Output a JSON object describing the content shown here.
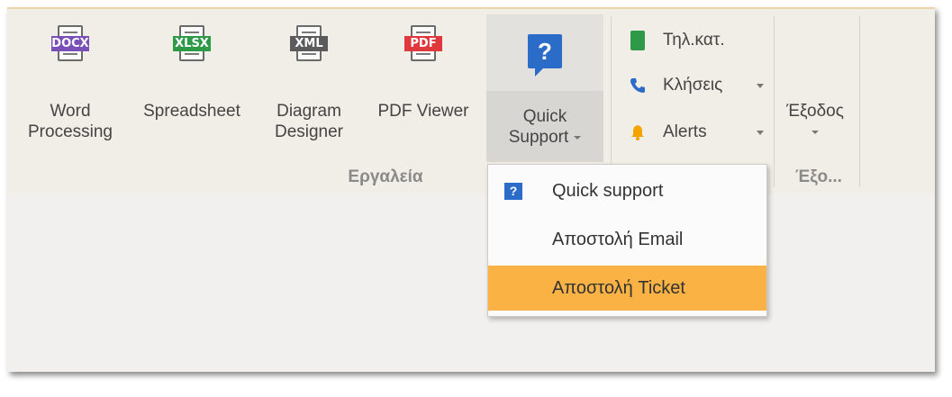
{
  "ribbon": {
    "buttons": [
      {
        "id": "word",
        "tag": "DOCX",
        "label_1": "Word",
        "label_2": "Processing",
        "color": "#7a4fb8"
      },
      {
        "id": "spreadsheet",
        "tag": "XLSX",
        "label_1": "Spreadsheet",
        "label_2": "",
        "color": "#2e9a48"
      },
      {
        "id": "diagram",
        "tag": "XML",
        "label_1": "Diagram",
        "label_2": "Designer",
        "color": "#5b5b5b"
      },
      {
        "id": "pdf",
        "tag": "PDF",
        "label_1": "PDF Viewer",
        "label_2": "",
        "color": "#e0393d"
      }
    ],
    "quick_support": {
      "label_1": "Quick",
      "label_2": "Support",
      "icon_glyph": "?"
    },
    "small_items": [
      {
        "label": "Τηλ.κατ.",
        "icon": "phonebook-icon",
        "color": "#2e9a48",
        "has_caret": false
      },
      {
        "label": "Κλήσεις",
        "icon": "phone-icon",
        "color": "#2b6cc9",
        "has_caret": true
      },
      {
        "label": "Alerts",
        "icon": "bell-icon",
        "color": "#f4a300",
        "has_caret": true
      }
    ],
    "exit": {
      "label": "Έξοδος",
      "icon": "power-icon",
      "color": "#e0272c"
    },
    "groups": {
      "tools": "Εργαλεία",
      "exit": "Έξο..."
    }
  },
  "dropdown": {
    "items": [
      {
        "label": "Quick support",
        "icon": "question-icon",
        "highlighted": false
      },
      {
        "label": "Αποστολή Email",
        "icon": "",
        "highlighted": false
      },
      {
        "label": "Αποστολή Ticket",
        "icon": "",
        "highlighted": true
      }
    ]
  }
}
